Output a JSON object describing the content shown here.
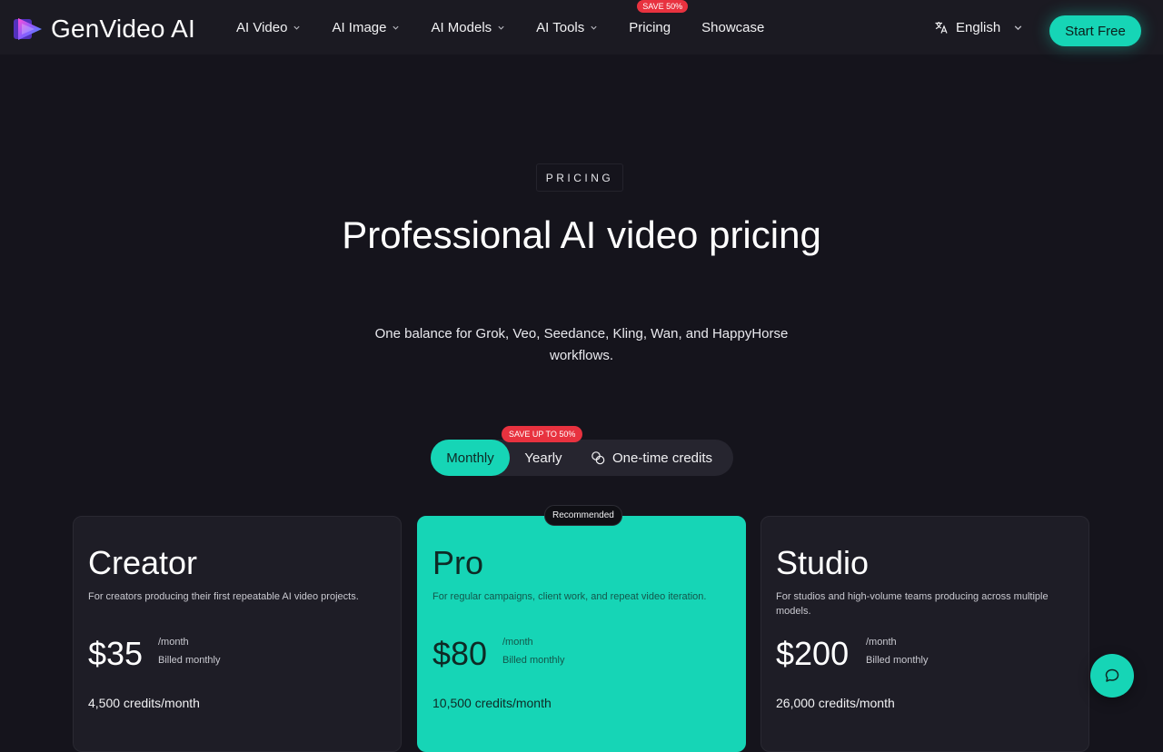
{
  "brand": {
    "name": "GenVideo AI",
    "accent": "#16d5b6"
  },
  "nav": {
    "items": [
      {
        "label": "AI Video",
        "has_menu": true
      },
      {
        "label": "AI Image",
        "has_menu": true
      },
      {
        "label": "AI Models",
        "has_menu": true
      },
      {
        "label": "AI Tools",
        "has_menu": true
      },
      {
        "label": "Pricing",
        "has_menu": false,
        "badge": "SAVE 50%"
      },
      {
        "label": "Showcase",
        "has_menu": false
      }
    ],
    "language": "English",
    "cta": "Start Free"
  },
  "hero": {
    "eyebrow": "PRICING",
    "title": "Professional AI video pricing",
    "subtitle": "One balance for Grok, Veo, Seedance, Kling, Wan, and HappyHorse workflows."
  },
  "billing": {
    "options": [
      "Monthly",
      "Yearly",
      "One-time credits"
    ],
    "selected": "Monthly",
    "yearly_badge": "SAVE UP TO 50%"
  },
  "plans": [
    {
      "name": "Creator",
      "description": "For creators producing their first repeatable AI video projects.",
      "price": "$35",
      "period": "/month",
      "billing_note": "Billed monthly",
      "credits": "4,500 credits/month",
      "recommended": false
    },
    {
      "name": "Pro",
      "description": "For regular campaigns, client work, and repeat video iteration.",
      "price": "$80",
      "period": "/month",
      "billing_note": "Billed monthly",
      "credits": "10,500 credits/month",
      "recommended": true,
      "badge": "Recommended"
    },
    {
      "name": "Studio",
      "description": "For studios and high-volume teams producing across multiple models.",
      "price": "$200",
      "period": "/month",
      "billing_note": "Billed monthly",
      "credits": "26,000 credits/month",
      "recommended": false
    }
  ],
  "icons": {
    "language": "translate-icon",
    "chat": "chat-bubble-icon",
    "credits": "coins-icon"
  }
}
